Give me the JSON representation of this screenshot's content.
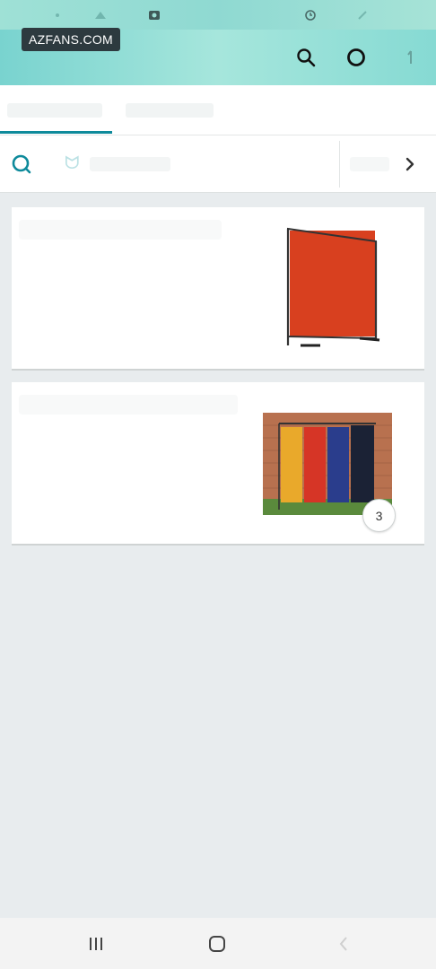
{
  "watermark": {
    "text": "AZFANS.COM"
  },
  "header": {
    "icons": [
      "search-icon",
      "alexa-icon",
      "cart-icon"
    ]
  },
  "filter": {
    "glyph": "ᗢ"
  },
  "results": [
    {
      "image": "red-welding-curtain",
      "color": "#d8401f"
    },
    {
      "image": "multicolor-welding-curtains",
      "colors": [
        "#e9a92b",
        "#d63526",
        "#2a3d8c",
        "#1b2235"
      ],
      "image_count": "3"
    }
  ],
  "nav": {
    "icons": [
      "recents-icon",
      "home-icon",
      "back-icon"
    ]
  },
  "colors": {
    "accent": "#0e8a9b",
    "header_start": "#79d3cf",
    "header_end": "#a6e6dc",
    "page_bg": "#e8ecee"
  }
}
